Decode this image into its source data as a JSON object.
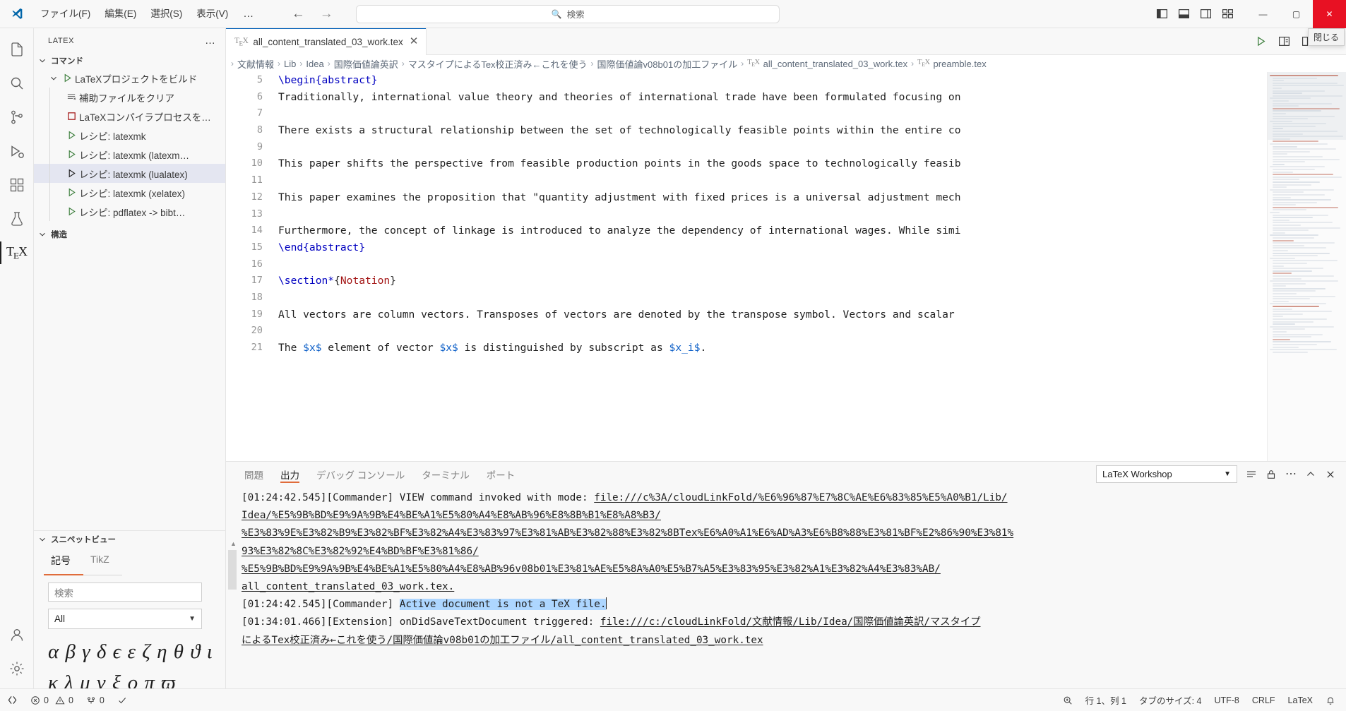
{
  "titlebar": {
    "menus": [
      "ファイル(F)",
      "編集(E)",
      "選択(S)",
      "表示(V)"
    ],
    "more_label": "…",
    "back_icon": "arrow-left-icon",
    "forward_icon": "arrow-right-icon",
    "search_placeholder": "検索",
    "search_icon": "search-icon",
    "layout_icons": [
      "primary-sidebar-toggle-icon",
      "panel-toggle-icon",
      "secondary-sidebar-toggle-icon",
      "customize-layout-icon"
    ],
    "minimize_label": "—",
    "maximize_label": "▢",
    "close_label": "✕",
    "close_tooltip": "閉じる"
  },
  "activitybar": {
    "items": [
      {
        "name": "explorer",
        "icon": "files-icon"
      },
      {
        "name": "search",
        "icon": "search-icon"
      },
      {
        "name": "source-control",
        "icon": "source-control-icon"
      },
      {
        "name": "run-and-debug",
        "icon": "debug-icon"
      },
      {
        "name": "extensions",
        "icon": "extensions-icon"
      },
      {
        "name": "testing",
        "icon": "beaker-icon"
      },
      {
        "name": "latex-workshop",
        "icon": "tex-icon",
        "active": true
      }
    ],
    "bottom": [
      {
        "name": "accounts",
        "icon": "account-icon"
      },
      {
        "name": "manage",
        "icon": "gear-icon"
      }
    ]
  },
  "sidebar": {
    "title": "LATEX",
    "more_label": "…",
    "sections": [
      {
        "label": "コマンド",
        "expanded": true
      },
      {
        "label": "構造",
        "expanded": true
      }
    ],
    "commands": [
      {
        "label": "LaTeXプロジェクトをビルド",
        "icon": "play-icon",
        "depth": 1,
        "expandable": true,
        "selected": false
      },
      {
        "label": "補助ファイルをクリア",
        "icon": "clear-icon",
        "depth": 2,
        "selected": false
      },
      {
        "label": "LaTeXコンパイラプロセスを…",
        "icon": "stop-icon",
        "depth": 2,
        "selected": false
      },
      {
        "label": "レシピ: latexmk",
        "icon": "play-icon",
        "depth": 2,
        "selected": false
      },
      {
        "label": "レシピ: latexmk (latexm…",
        "icon": "play-icon",
        "depth": 2,
        "selected": false
      },
      {
        "label": "レシピ: latexmk (lualatex)",
        "icon": "play-icon",
        "depth": 2,
        "selected": true
      },
      {
        "label": "レシピ: latexmk (xelatex)",
        "icon": "play-icon",
        "depth": 2,
        "selected": false
      },
      {
        "label": "レシピ: pdflatex -> bibt…",
        "icon": "play-icon",
        "depth": 2,
        "selected": false
      }
    ],
    "snippet": {
      "title": "スニペットビュー",
      "tabs": [
        {
          "label": "記号",
          "active": true
        },
        {
          "label": "TikZ",
          "active": false
        }
      ],
      "search_placeholder": "検索",
      "filter_value": "All",
      "symbols_row1": "α β γ δ ϵ ε ζ η θ ϑ ι",
      "symbols_row2": "κ λ μ ν ξ ο π ϖ"
    }
  },
  "editor": {
    "tab": {
      "label": "all_content_translated_03_work.tex",
      "icon": "tex-icon",
      "close_label": "✕"
    },
    "tab_actions": [
      "run-icon",
      "split-pdf-icon",
      "split-editor-icon",
      "more-actions-icon"
    ],
    "breadcrumb": [
      {
        "label": "文献情報"
      },
      {
        "label": "Lib"
      },
      {
        "label": "Idea"
      },
      {
        "label": "国際価値論英訳"
      },
      {
        "label": "マスタイプによるTex校正済み←これを使う"
      },
      {
        "label": "国際価値論v08b01の加工ファイル"
      },
      {
        "label": "all_content_translated_03_work.tex",
        "icon": "tex-icon"
      },
      {
        "label": "preamble.tex",
        "icon": "tex-icon"
      }
    ],
    "lines": [
      {
        "num": "5",
        "segments": [
          {
            "t": "\\begin{abstract}",
            "c": "kw"
          }
        ]
      },
      {
        "num": "6",
        "segments": [
          {
            "t": "Traditionally, international value theory and theories of international trade have been formulated focusing on",
            "c": ""
          }
        ]
      },
      {
        "num": "7",
        "segments": [
          {
            "t": "",
            "c": ""
          }
        ]
      },
      {
        "num": "8",
        "segments": [
          {
            "t": "There exists a structural relationship between the set of technologically feasible points within the entire co",
            "c": ""
          }
        ]
      },
      {
        "num": "9",
        "segments": [
          {
            "t": "",
            "c": ""
          }
        ]
      },
      {
        "num": "10",
        "segments": [
          {
            "t": "This paper shifts the perspective from feasible production points in the goods space to technologically feasib",
            "c": ""
          }
        ]
      },
      {
        "num": "11",
        "segments": [
          {
            "t": "",
            "c": ""
          }
        ]
      },
      {
        "num": "12",
        "segments": [
          {
            "t": "This paper examines the proposition that \"quantity adjustment with fixed prices is a universal adjustment mech",
            "c": ""
          }
        ]
      },
      {
        "num": "13",
        "segments": [
          {
            "t": "",
            "c": ""
          }
        ]
      },
      {
        "num": "14",
        "segments": [
          {
            "t": "Furthermore, the concept of linkage is introduced to analyze the dependency of international wages. While simi",
            "c": ""
          }
        ]
      },
      {
        "num": "15",
        "segments": [
          {
            "t": "\\end{abstract}",
            "c": "kw"
          }
        ]
      },
      {
        "num": "16",
        "segments": [
          {
            "t": "",
            "c": ""
          }
        ]
      },
      {
        "num": "17",
        "segments": [
          {
            "t": "\\section*",
            "c": "kw"
          },
          {
            "t": "{",
            "c": ""
          },
          {
            "t": "Notation",
            "c": "cmdv"
          },
          {
            "t": "}",
            "c": ""
          }
        ]
      },
      {
        "num": "18",
        "segments": [
          {
            "t": "",
            "c": ""
          }
        ]
      },
      {
        "num": "19",
        "segments": [
          {
            "t": "All vectors are column vectors. Transposes of vectors are denoted by the transpose symbol. Vectors and scalar",
            "c": ""
          }
        ]
      },
      {
        "num": "20",
        "segments": [
          {
            "t": "",
            "c": ""
          }
        ]
      },
      {
        "num": "21",
        "segments": [
          {
            "t": "The ",
            "c": ""
          },
          {
            "t": "$x$",
            "c": "math"
          },
          {
            "t": " element of vector ",
            "c": ""
          },
          {
            "t": "$x$",
            "c": "math"
          },
          {
            "t": " is distinguished by subscript as ",
            "c": ""
          },
          {
            "t": "$x_i$",
            "c": "math"
          },
          {
            "t": ".",
            "c": ""
          }
        ]
      }
    ]
  },
  "panel": {
    "tabs": [
      {
        "label": "問題",
        "active": false
      },
      {
        "label": "出力",
        "active": true
      },
      {
        "label": "デバッグ コンソール",
        "active": false
      },
      {
        "label": "ターミナル",
        "active": false
      },
      {
        "label": "ポート",
        "active": false
      }
    ],
    "channel": "LaTeX Workshop",
    "actions": [
      "clear-output-icon",
      "lock-icon",
      "more-actions-icon",
      "maximize-panel-icon",
      "close-panel-icon"
    ],
    "log_lines": [
      [
        {
          "t": "[01:24:42.545][Commander] VIEW command invoked with mode: ",
          "s": "plain"
        },
        {
          "t": "file:///c%3A/cloudLinkFold/%E6%96%87%E7%8C%AE%E6%83%85%E5%A0%B1/Lib/",
          "s": "link"
        }
      ],
      [
        {
          "t": "Idea/%E5%9B%BD%E9%9A%9B%E4%BE%A1%E5%80%A4%E8%AB%96%E8%8B%B1%E8%A8%B3/",
          "s": "link"
        }
      ],
      [
        {
          "t": "%E3%83%9E%E3%82%B9%E3%82%BF%E3%82%A4%E3%83%97%E3%81%AB%E3%82%88%E3%82%8BTex%E6%A0%A1%E6%AD%A3%E6%B8%88%E3%81%BF%E2%86%90%E3%81%",
          "s": "link"
        }
      ],
      [
        {
          "t": "93%E3%82%8C%E3%82%92%E4%BD%BF%E3%81%86/",
          "s": "link"
        }
      ],
      [
        {
          "t": "%E5%9B%BD%E9%9A%9B%E4%BE%A1%E5%80%A4%E8%AB%96v08b01%E3%81%AE%E5%8A%A0%E5%B7%A5%E3%83%95%E3%82%A1%E3%82%A4%E3%83%AB/",
          "s": "link"
        }
      ],
      [
        {
          "t": "all_content_translated_03_work.tex.",
          "s": "link"
        }
      ],
      [
        {
          "t": "[01:24:42.545][Commander] ",
          "s": "plain"
        },
        {
          "t": "Active document is not a TeX file.",
          "s": "highlight"
        }
      ],
      [
        {
          "t": "[01:34:01.466][Extension] onDidSaveTextDocument triggered: ",
          "s": "plain"
        },
        {
          "t": "file:///c:/cloudLinkFold/文献情報/Lib/Idea/国際価値論英訳/マスタイプ",
          "s": "link"
        }
      ],
      [
        {
          "t": "によるTex校正済み←これを使う/国際価値論v08b01の加工ファイル/all_content_translated_03_work.tex",
          "s": "link"
        }
      ]
    ]
  },
  "statusbar": {
    "remote_icon": "remote-icon",
    "problems": {
      "errors": "0",
      "warnings": "0",
      "error_icon": "error-icon",
      "warning_icon": "warning-icon"
    },
    "ports": {
      "count": "0",
      "icon": "ports-icon"
    },
    "check_icon": "check-icon",
    "right": [
      {
        "label": "",
        "icon": "zoom-icon"
      },
      {
        "label": "行 1、列 1",
        "icon": ""
      },
      {
        "label": "タブのサイズ: 4",
        "icon": ""
      },
      {
        "label": "UTF-8",
        "icon": ""
      },
      {
        "label": "CRLF",
        "icon": ""
      },
      {
        "label": "LaTeX",
        "icon": ""
      },
      {
        "label": "",
        "icon": "bell-icon"
      }
    ]
  },
  "colors": {
    "accent": "#005fb8",
    "close_red": "#e81123",
    "tab_underline": "#e06c3b",
    "selection_blue": "#add6ff",
    "play_green": "#3c7e3c",
    "stop_red": "#a31515"
  }
}
